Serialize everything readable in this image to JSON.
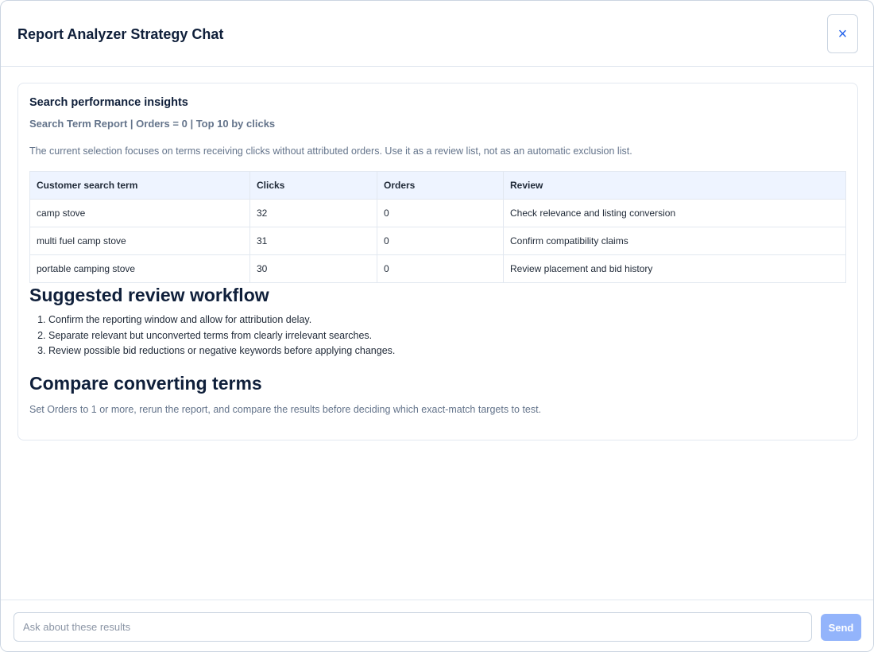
{
  "dialog": {
    "title": "Report Analyzer Strategy Chat",
    "close_glyph": "×"
  },
  "insights": {
    "title": "Search performance insights",
    "subtitle": "Search Term Report | Orders = 0 | Top 10 by clicks",
    "description": "The current selection focuses on terms receiving clicks without attributed orders. Use it as a review list, not as an automatic exclusion list.",
    "table": {
      "headers": [
        "Customer search term",
        "Clicks",
        "Orders",
        "Review"
      ],
      "rows": [
        [
          "camp stove",
          "32",
          "0",
          "Check relevance and listing conversion"
        ],
        [
          "multi fuel camp stove",
          "31",
          "0",
          "Confirm compatibility claims"
        ],
        [
          "portable camping stove",
          "30",
          "0",
          "Review placement and bid history"
        ]
      ]
    },
    "workflow": {
      "heading": "Suggested review workflow",
      "steps": [
        "Confirm the reporting window and allow for attribution delay.",
        "Separate relevant but unconverted terms from clearly irrelevant searches.",
        "Review possible bid reductions or negative keywords before applying changes."
      ]
    },
    "compare": {
      "heading": "Compare converting terms",
      "text": "Set Orders to 1 or more, rerun the report, and compare the results before deciding which exact-match targets to test."
    }
  },
  "composer": {
    "placeholder": "Ask about these results",
    "value": "",
    "send_label": "Send"
  },
  "colors": {
    "accent": "#2563eb",
    "send_button": "#93b4fb",
    "table_header_bg": "#eef4ff",
    "heading": "#0f1f3a",
    "muted": "#64748b"
  }
}
